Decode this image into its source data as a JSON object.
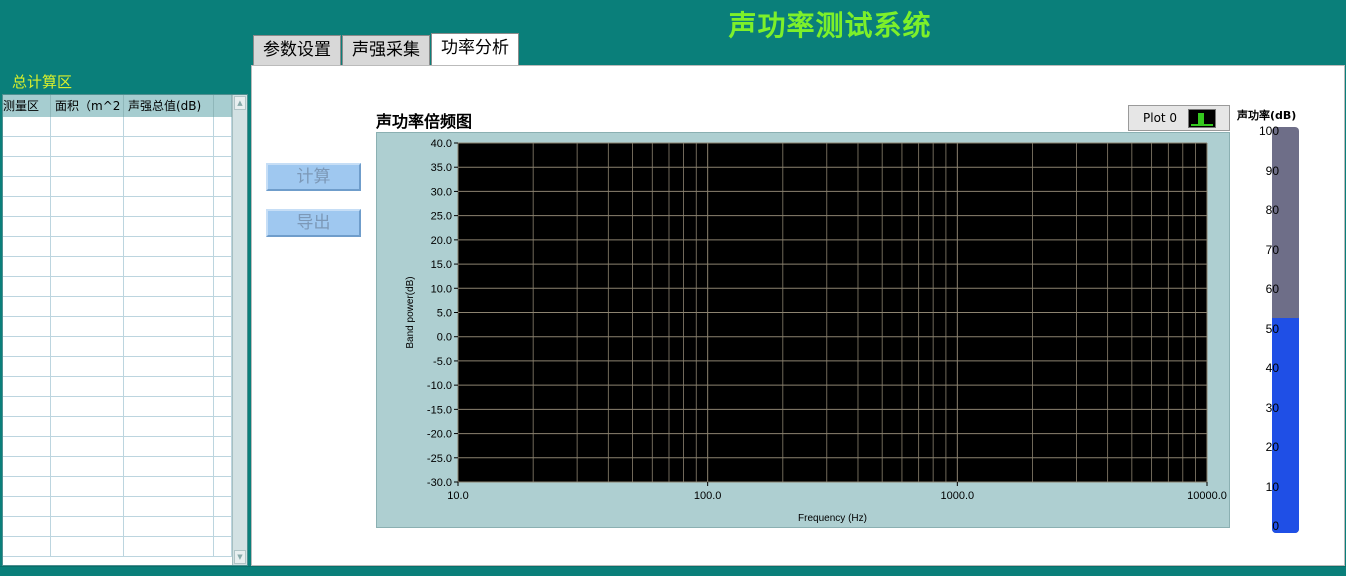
{
  "app": {
    "title": "声功率测试系统"
  },
  "left_panel": {
    "title": "总计算区",
    "table": {
      "columns": [
        "测量区",
        "面积（m^2",
        "声强总值(dB)",
        ""
      ],
      "rows": []
    }
  },
  "tabs": [
    {
      "label": "参数设置",
      "active": false
    },
    {
      "label": "声强采集",
      "active": false
    },
    {
      "label": "功率分析",
      "active": true
    }
  ],
  "buttons": {
    "calc": "计算",
    "export": "导出"
  },
  "graph": {
    "title": "声功率倍频图",
    "legend_label": "Plot 0",
    "legend_color": "#35c91f",
    "plot_bg": "#000000",
    "grid_color": "#8c8370"
  },
  "chart_data": {
    "type": "line",
    "title": "声功率倍频图",
    "xlabel": "Frequency (Hz)",
    "ylabel": "Band power(dB)",
    "xscale": "log",
    "xlim": [
      10,
      10000
    ],
    "ylim": [
      -30,
      40
    ],
    "x_ticks": [
      "10.0",
      "100.0",
      "1000.0",
      "10000.0"
    ],
    "y_ticks": [
      "40.0",
      "35.0",
      "30.0",
      "25.0",
      "20.0",
      "15.0",
      "10.0",
      "5.0",
      "0.0",
      "-5.0",
      "-10.0",
      "-15.0",
      "-20.0",
      "-25.0",
      "-30.0"
    ],
    "grid": true,
    "series": [
      {
        "name": "Plot 0",
        "x": [],
        "y": []
      }
    ]
  },
  "meter": {
    "title": "声功率(dB)",
    "min": 0,
    "max": 100,
    "value": 53,
    "ticks": [
      "100",
      "90",
      "80",
      "70",
      "60",
      "50",
      "40",
      "30",
      "20",
      "10",
      "0"
    ],
    "fill_color": "#1f4fe6",
    "track_color": "#6e6e88"
  }
}
